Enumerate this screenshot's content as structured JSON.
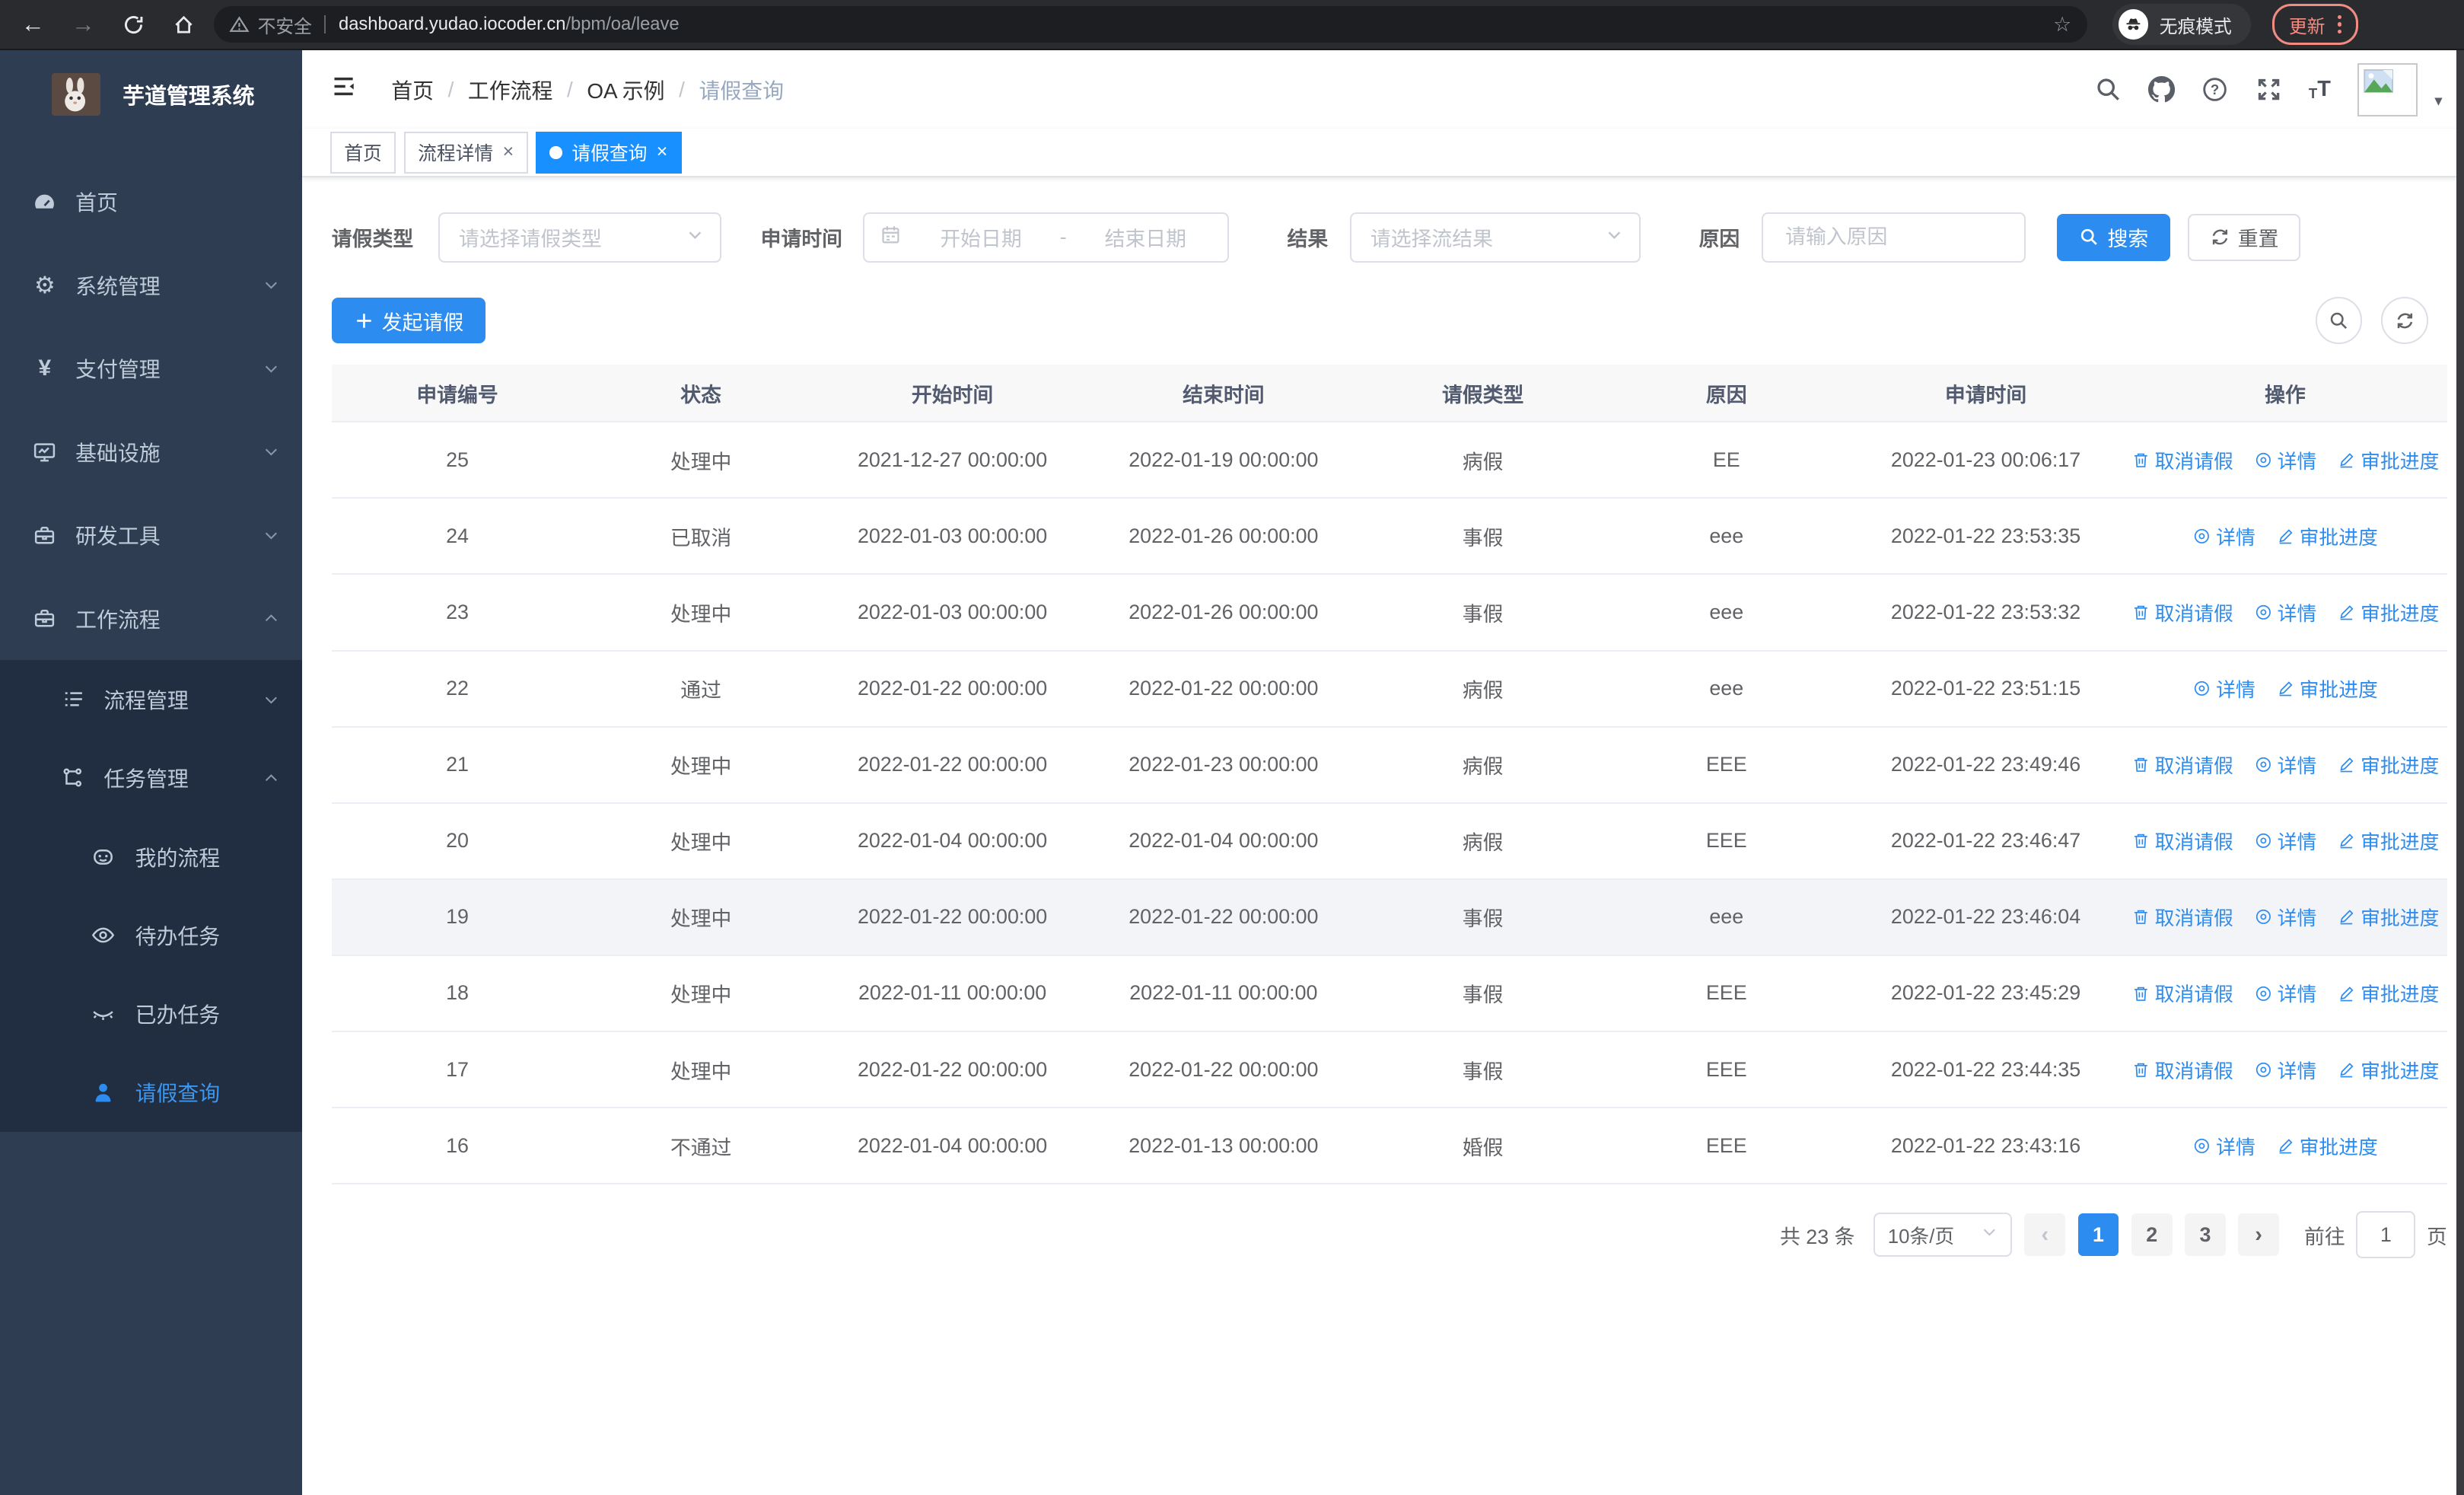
{
  "browser": {
    "security_label": "不安全",
    "url_host": "dashboard.yudao.iocoder.cn",
    "url_path": "/bpm/oa/leave",
    "incognito_label": "无痕模式",
    "update_label": "更新"
  },
  "sidebar": {
    "app_title": "芋道管理系统",
    "menu": [
      {
        "label": "首页",
        "icon": "dashboard-icon",
        "chevron": ""
      },
      {
        "label": "系统管理",
        "icon": "gear-icon",
        "chevron": "down"
      },
      {
        "label": "支付管理",
        "icon": "yen-icon",
        "chevron": "down"
      },
      {
        "label": "基础设施",
        "icon": "monitor-icon",
        "chevron": "down"
      },
      {
        "label": "研发工具",
        "icon": "toolbox-icon",
        "chevron": "down"
      },
      {
        "label": "工作流程",
        "icon": "briefcase-icon",
        "chevron": "up"
      }
    ],
    "submenu": [
      {
        "label": "流程管理",
        "icon": "list-icon",
        "chevron": "down",
        "level": 2,
        "active": false
      },
      {
        "label": "任务管理",
        "icon": "flow-icon",
        "chevron": "up",
        "level": 2,
        "active": false
      },
      {
        "label": "我的流程",
        "icon": "robot-icon",
        "chevron": "",
        "level": 3,
        "active": false
      },
      {
        "label": "待办任务",
        "icon": "eye-icon",
        "chevron": "",
        "level": 3,
        "active": false
      },
      {
        "label": "已办任务",
        "icon": "eye-closed-icon",
        "chevron": "",
        "level": 3,
        "active": false
      },
      {
        "label": "请假查询",
        "icon": "user-icon",
        "chevron": "",
        "level": 3,
        "active": true
      }
    ]
  },
  "header": {
    "breadcrumb": [
      "首页",
      "工作流程",
      "OA 示例",
      "请假查询"
    ],
    "breadcrumb_separator": "/"
  },
  "tabs": [
    {
      "label": "首页",
      "closable": false,
      "active": false
    },
    {
      "label": "流程详情",
      "closable": true,
      "active": false
    },
    {
      "label": "请假查询",
      "closable": true,
      "active": true
    }
  ],
  "close_glyph": "×",
  "filters": {
    "leave_type_label": "请假类型",
    "leave_type_placeholder": "请选择请假类型",
    "apply_time_label": "申请时间",
    "date_start_placeholder": "开始日期",
    "date_separator": "-",
    "date_end_placeholder": "结束日期",
    "result_label": "结果",
    "result_placeholder": "请选择流结果",
    "reason_label": "原因",
    "reason_placeholder": "请输入原因",
    "search_label": "搜索",
    "reset_label": "重置"
  },
  "toolbar": {
    "create_label": "发起请假"
  },
  "table": {
    "columns": [
      "申请编号",
      "状态",
      "开始时间",
      "结束时间",
      "请假类型",
      "原因",
      "申请时间",
      "操作"
    ],
    "action_labels": {
      "cancel": "取消请假",
      "detail": "详情",
      "progress": "审批进度"
    },
    "action_icons": {
      "cancel": "trash-icon",
      "detail": "view-icon",
      "progress": "edit-icon"
    },
    "rows": [
      {
        "id": "25",
        "status": "处理中",
        "start": "2021-12-27 00:00:00",
        "end": "2022-01-19 00:00:00",
        "type": "病假",
        "reason": "EE",
        "apply": "2022-01-23 00:06:17",
        "actions": [
          "cancel",
          "detail",
          "progress"
        ],
        "hover": false
      },
      {
        "id": "24",
        "status": "已取消",
        "start": "2022-01-03 00:00:00",
        "end": "2022-01-26 00:00:00",
        "type": "事假",
        "reason": "eee",
        "apply": "2022-01-22 23:53:35",
        "actions": [
          "detail",
          "progress"
        ],
        "hover": false
      },
      {
        "id": "23",
        "status": "处理中",
        "start": "2022-01-03 00:00:00",
        "end": "2022-01-26 00:00:00",
        "type": "事假",
        "reason": "eee",
        "apply": "2022-01-22 23:53:32",
        "actions": [
          "cancel",
          "detail",
          "progress"
        ],
        "hover": false
      },
      {
        "id": "22",
        "status": "通过",
        "start": "2022-01-22 00:00:00",
        "end": "2022-01-22 00:00:00",
        "type": "病假",
        "reason": "eee",
        "apply": "2022-01-22 23:51:15",
        "actions": [
          "detail",
          "progress"
        ],
        "hover": false
      },
      {
        "id": "21",
        "status": "处理中",
        "start": "2022-01-22 00:00:00",
        "end": "2022-01-23 00:00:00",
        "type": "病假",
        "reason": "EEE",
        "apply": "2022-01-22 23:49:46",
        "actions": [
          "cancel",
          "detail",
          "progress"
        ],
        "hover": false
      },
      {
        "id": "20",
        "status": "处理中",
        "start": "2022-01-04 00:00:00",
        "end": "2022-01-04 00:00:00",
        "type": "病假",
        "reason": "EEE",
        "apply": "2022-01-22 23:46:47",
        "actions": [
          "cancel",
          "detail",
          "progress"
        ],
        "hover": false
      },
      {
        "id": "19",
        "status": "处理中",
        "start": "2022-01-22 00:00:00",
        "end": "2022-01-22 00:00:00",
        "type": "事假",
        "reason": "eee",
        "apply": "2022-01-22 23:46:04",
        "actions": [
          "cancel",
          "detail",
          "progress"
        ],
        "hover": true
      },
      {
        "id": "18",
        "status": "处理中",
        "start": "2022-01-11 00:00:00",
        "end": "2022-01-11 00:00:00",
        "type": "事假",
        "reason": "EEE",
        "apply": "2022-01-22 23:45:29",
        "actions": [
          "cancel",
          "detail",
          "progress"
        ],
        "hover": false
      },
      {
        "id": "17",
        "status": "处理中",
        "start": "2022-01-22 00:00:00",
        "end": "2022-01-22 00:00:00",
        "type": "事假",
        "reason": "EEE",
        "apply": "2022-01-22 23:44:35",
        "actions": [
          "cancel",
          "detail",
          "progress"
        ],
        "hover": false
      },
      {
        "id": "16",
        "status": "不通过",
        "start": "2022-01-04 00:00:00",
        "end": "2022-01-13 00:00:00",
        "type": "婚假",
        "reason": "EEE",
        "apply": "2022-01-22 23:43:16",
        "actions": [
          "detail",
          "progress"
        ],
        "hover": false
      }
    ]
  },
  "pagination": {
    "total_label": "共 23 条",
    "page_size_value": "10条/页",
    "prev_glyph": "‹",
    "next_glyph": "›",
    "pages": [
      "1",
      "2",
      "3"
    ],
    "active_page": "1",
    "goto_label": "前往",
    "goto_value": "1",
    "goto_suffix": "页"
  },
  "colors": {
    "primary": "#2d8cf0",
    "tab_active": "#1890ff",
    "sidebar_bg": "#2f3d53",
    "submenu_bg": "#212d40",
    "update_accent": "#f28b82"
  }
}
